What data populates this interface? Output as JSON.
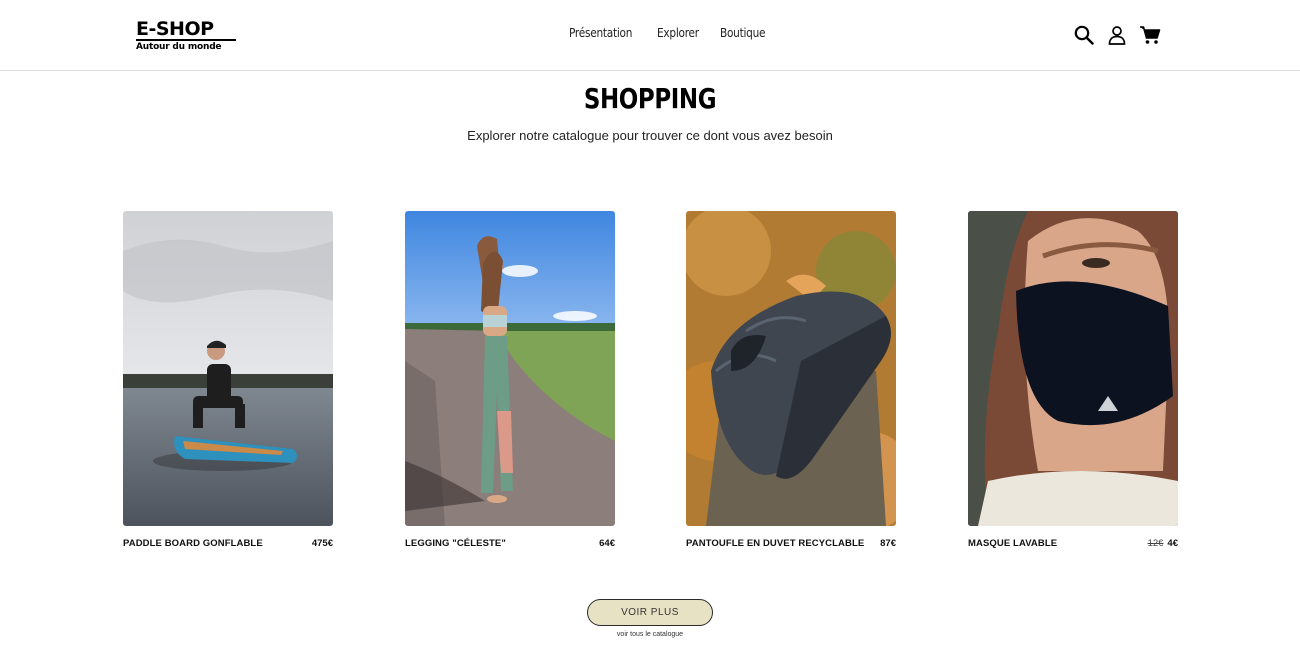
{
  "header": {
    "logo_main": "E-SHOP",
    "logo_sub": "Autour du monde",
    "nav": [
      {
        "label": "Présentation"
      },
      {
        "label": "Explorer"
      },
      {
        "label": "Boutique"
      }
    ],
    "icons": [
      "search-icon",
      "account-icon",
      "cart-icon"
    ]
  },
  "main": {
    "title": "SHOPPING",
    "subtitle": "Explorer notre catalogue pour trouver ce dont vous avez besoin"
  },
  "products": [
    {
      "name": "PADDLE BOARD GONFLABLE",
      "price": "475€",
      "old_price": ""
    },
    {
      "name": "LEGGING \"CÉLESTE\"",
      "price": "64€",
      "old_price": ""
    },
    {
      "name": "PANTOUFLE EN DUVET RECYCLABLE",
      "price": "87€",
      "old_price": ""
    },
    {
      "name": "MASQUE LAVABLE",
      "price": "4€",
      "old_price": "12€"
    }
  ],
  "cta": {
    "label": "VOIR PLUS",
    "caption": "voir tous le catalogue",
    "color": "#e8e2c5"
  }
}
